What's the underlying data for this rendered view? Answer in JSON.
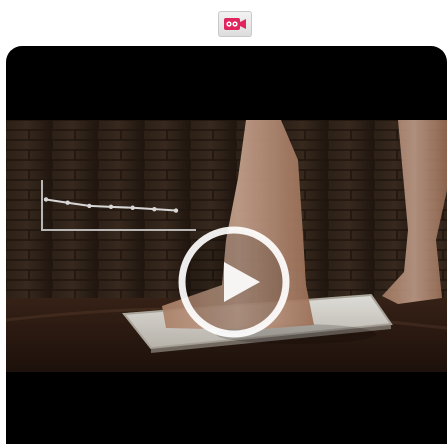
{
  "icons": {
    "top": "video-camera-icon",
    "play": "play-icon"
  },
  "colors": {
    "camera_icon": "#e0245e",
    "player_background": "#000000"
  },
  "video": {
    "scene": {
      "trend_line": [
        0.62,
        0.55,
        0.48,
        0.46,
        0.44,
        0.41,
        0.38
      ]
    }
  }
}
